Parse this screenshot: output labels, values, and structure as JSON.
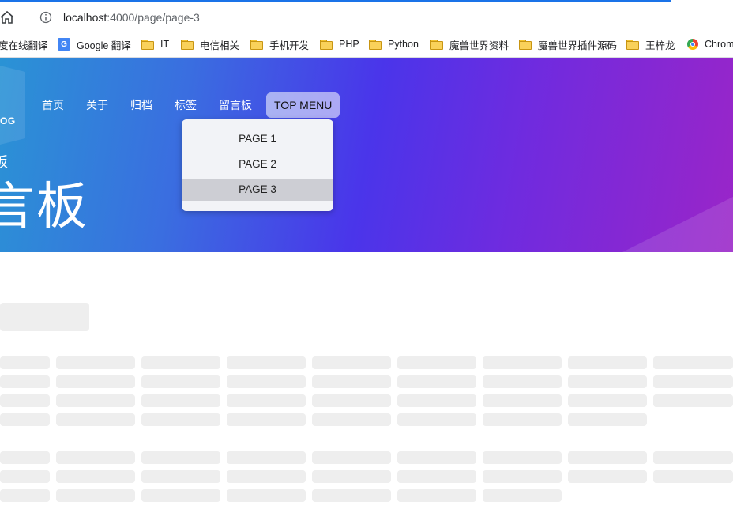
{
  "browser": {
    "url_host": "localhost",
    "url_path": ":4000/page/page-3",
    "bookmarks": [
      {
        "label": "度在线翻译",
        "icon": "none"
      },
      {
        "label": "Google 翻译",
        "icon": "google-translate-icon"
      },
      {
        "label": "IT",
        "icon": "folder-icon"
      },
      {
        "label": "电信相关",
        "icon": "folder-icon"
      },
      {
        "label": "手机开发",
        "icon": "folder-icon"
      },
      {
        "label": "PHP",
        "icon": "folder-icon"
      },
      {
        "label": "Python",
        "icon": "folder-icon"
      },
      {
        "label": "魔兽世界资料",
        "icon": "folder-icon"
      },
      {
        "label": "魔兽世界插件源码",
        "icon": "folder-icon"
      },
      {
        "label": "王梓龙",
        "icon": "folder-icon"
      },
      {
        "label": "Chrom",
        "icon": "chrome-icon"
      }
    ]
  },
  "site": {
    "logo": "OG",
    "nav": [
      "首页",
      "关于",
      "归档",
      "标签",
      "留言板",
      "TOP MENU"
    ],
    "dropdown": [
      "PAGE 1",
      "PAGE 2",
      "PAGE 3"
    ],
    "dropdown_selected": "PAGE 3",
    "hero_subtitle": "板",
    "hero_title": "言板"
  },
  "colors": {
    "hero_gradient": [
      "#2a93d5",
      "#4a35ea",
      "#9a25c8"
    ],
    "skeleton": "#eeeeee"
  }
}
